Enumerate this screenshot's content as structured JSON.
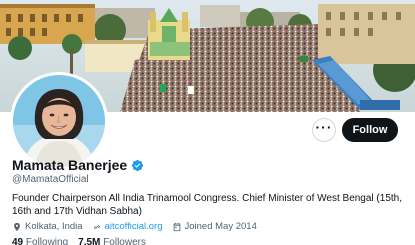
{
  "profile": {
    "name": "Mamata Banerjee",
    "handle": "@MamataOfficial",
    "bio": "Founder Chairperson All India Trinamool Congress. Chief Minister of West Bengal (15th, 16th and 17th Vidhan Sabha)",
    "location": "Kolkata, India",
    "website": "aitcofficial.org",
    "joined": "Joined May 2014",
    "following_count": "49",
    "following_label": "Following",
    "followers_count": "7.5M",
    "followers_label": "Followers"
  },
  "actions": {
    "more": "···",
    "follow": "Follow"
  },
  "colors": {
    "accent": "#1d9bf0",
    "follow_bg": "#0f1419",
    "muted": "#536471"
  },
  "icons": {
    "verified": "verified-badge-icon",
    "location": "location-pin-icon",
    "link": "link-icon",
    "calendar": "calendar-icon"
  }
}
